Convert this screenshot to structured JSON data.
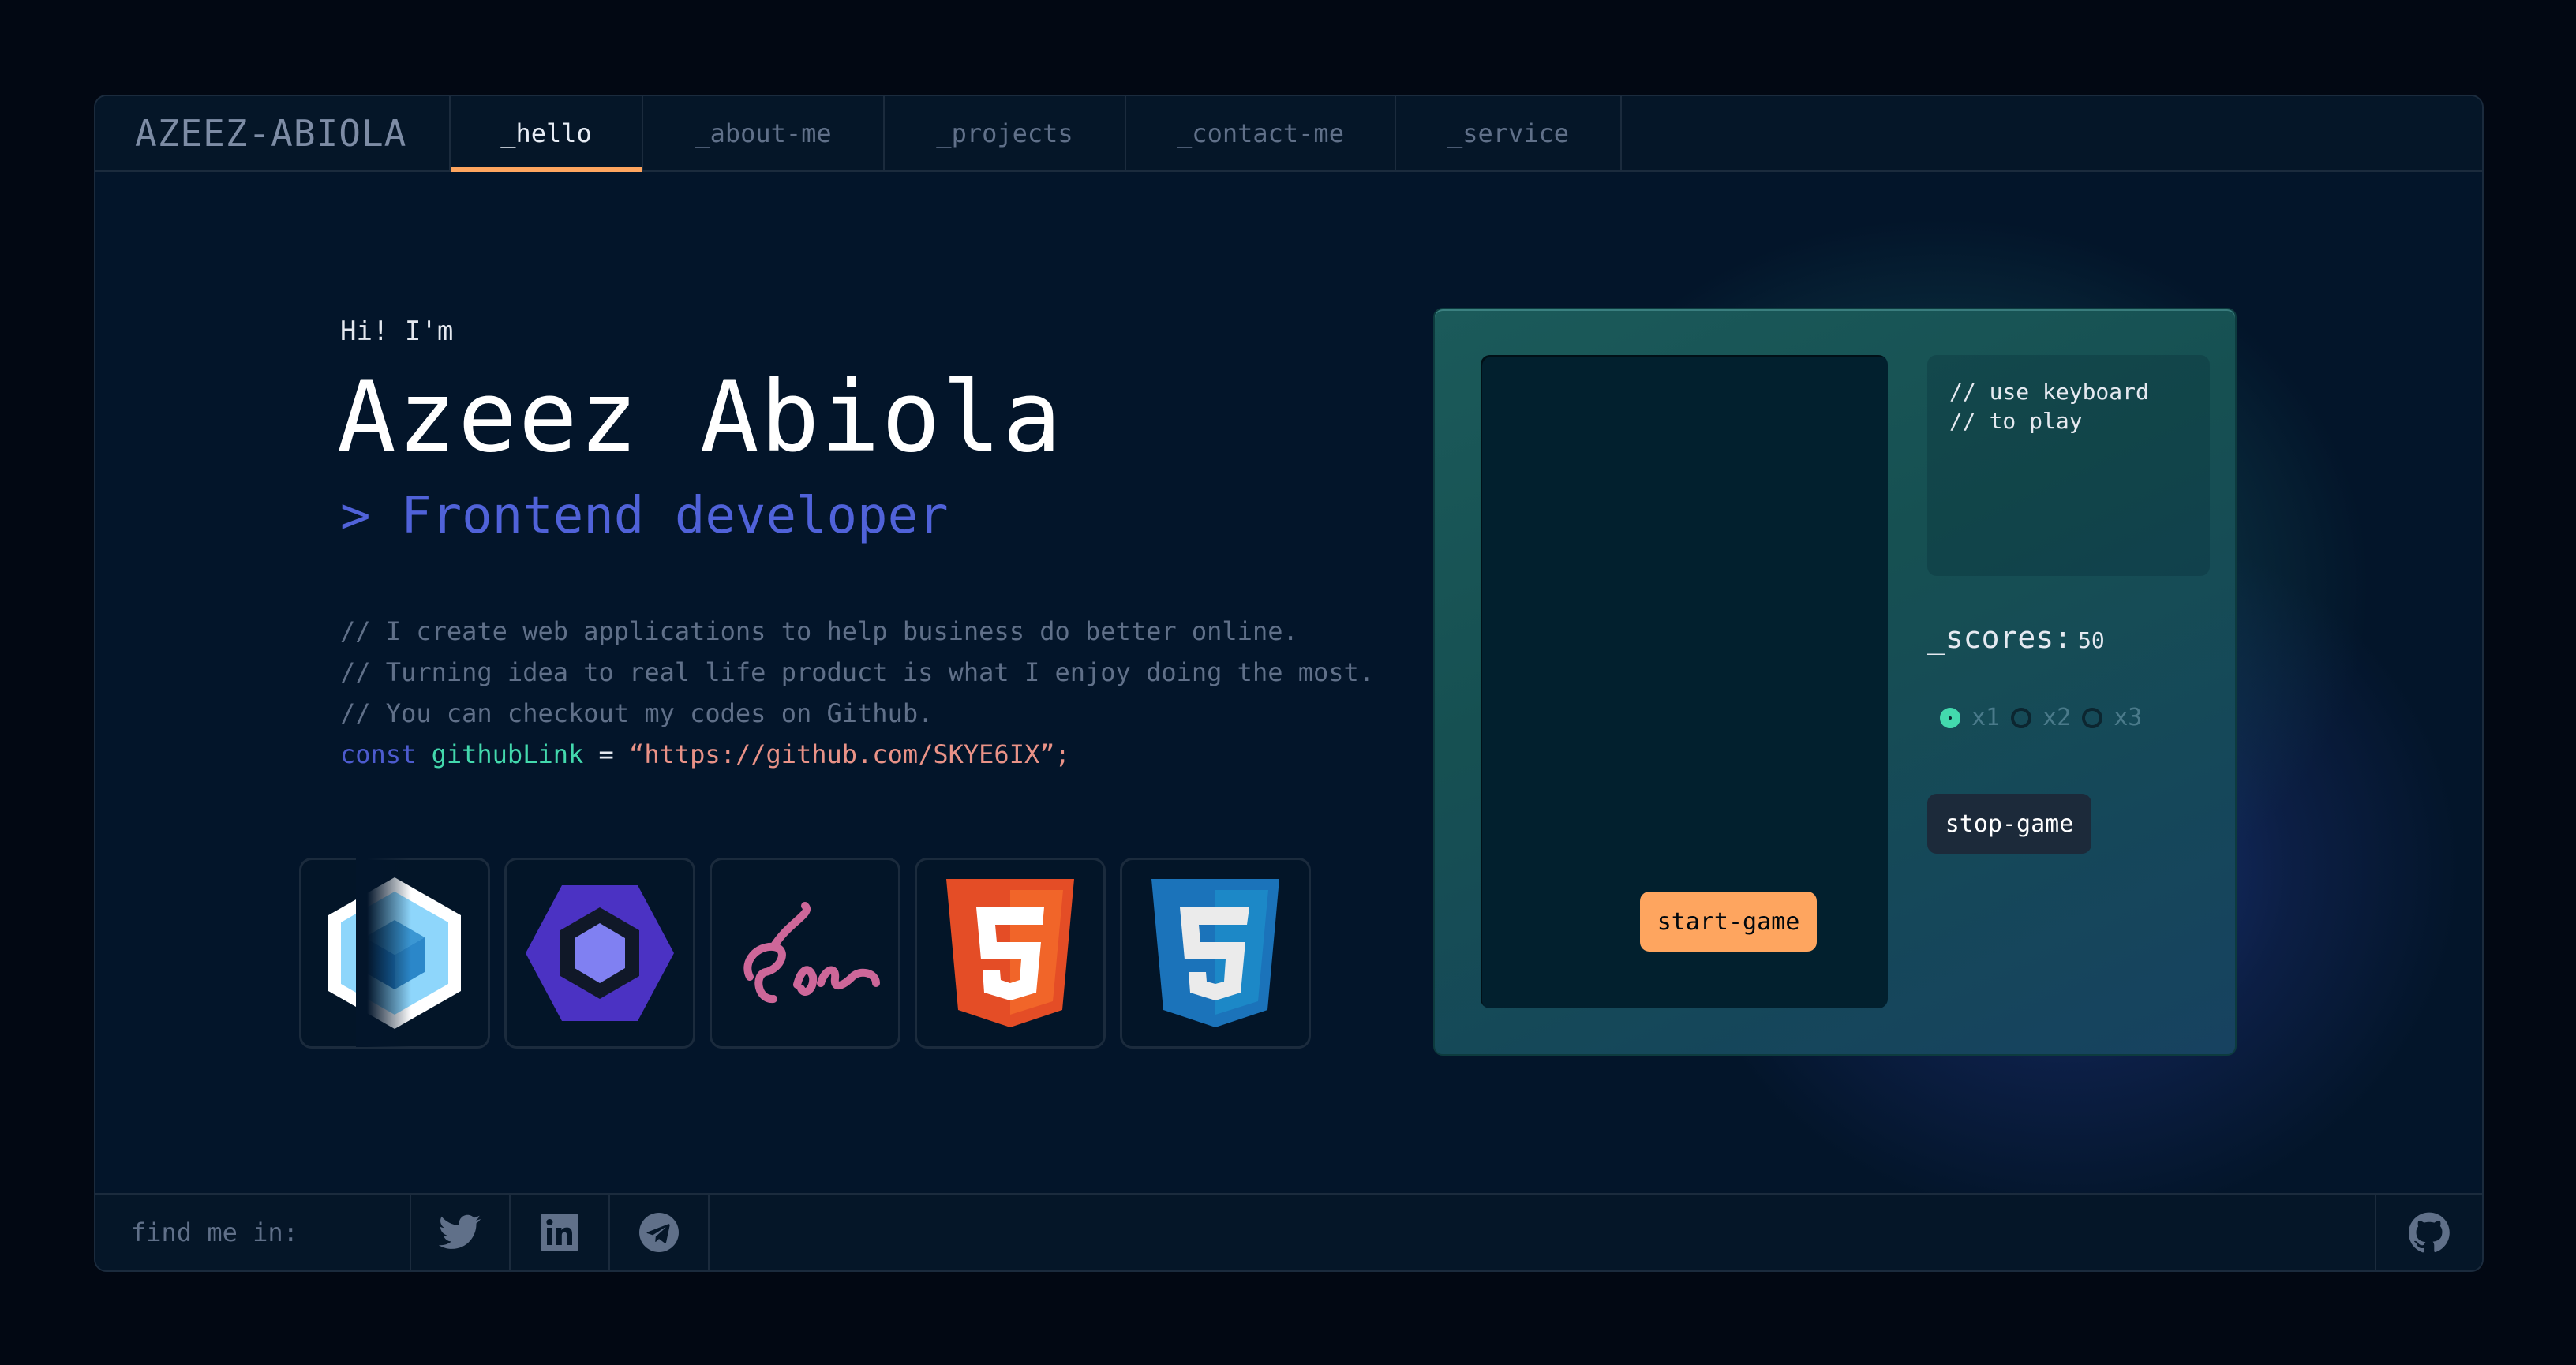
{
  "header": {
    "brand": "AZEEZ-ABIOLA",
    "tabs": [
      {
        "label": "_hello",
        "active": true
      },
      {
        "label": "_about-me",
        "active": false
      },
      {
        "label": "_projects",
        "active": false
      },
      {
        "label": "_contact-me",
        "active": false
      },
      {
        "label": "_service",
        "active": false
      }
    ]
  },
  "hero": {
    "greeting": "Hi! I'm",
    "name": "Azeez Abiola",
    "role": "> Frontend developer",
    "comments": [
      "// I create web applications to help business do better online.",
      "// Turning idea to real life product is what I enjoy doing the most.",
      "// You can checkout my codes on Github."
    ],
    "code": {
      "keyword": "const",
      "variable": "githubLink",
      "operator": " = ",
      "value": "“https://github.com/SKYE6IX”;"
    }
  },
  "tech_icons": [
    "webpack-icon",
    "eslint-icon",
    "sass-icon",
    "html5-icon",
    "css3-icon"
  ],
  "game": {
    "hint": "// use keyboard\n// to play",
    "scores_label": "_scores:",
    "scores_value": "50",
    "levels": [
      {
        "label": "x1",
        "selected": true
      },
      {
        "label": "x2",
        "selected": false
      },
      {
        "label": "x3",
        "selected": false
      }
    ],
    "start_label": "start-game",
    "stop_label": "stop-game"
  },
  "footer": {
    "find_label": "find me in:",
    "socials": [
      "twitter-icon",
      "linkedin-icon",
      "telegram-icon"
    ],
    "github": "github-icon"
  },
  "colors": {
    "accent_orange": "#fea55f",
    "accent_green": "#43d9ad",
    "accent_indigo": "#4d5bce",
    "string_pink": "#e99287"
  }
}
